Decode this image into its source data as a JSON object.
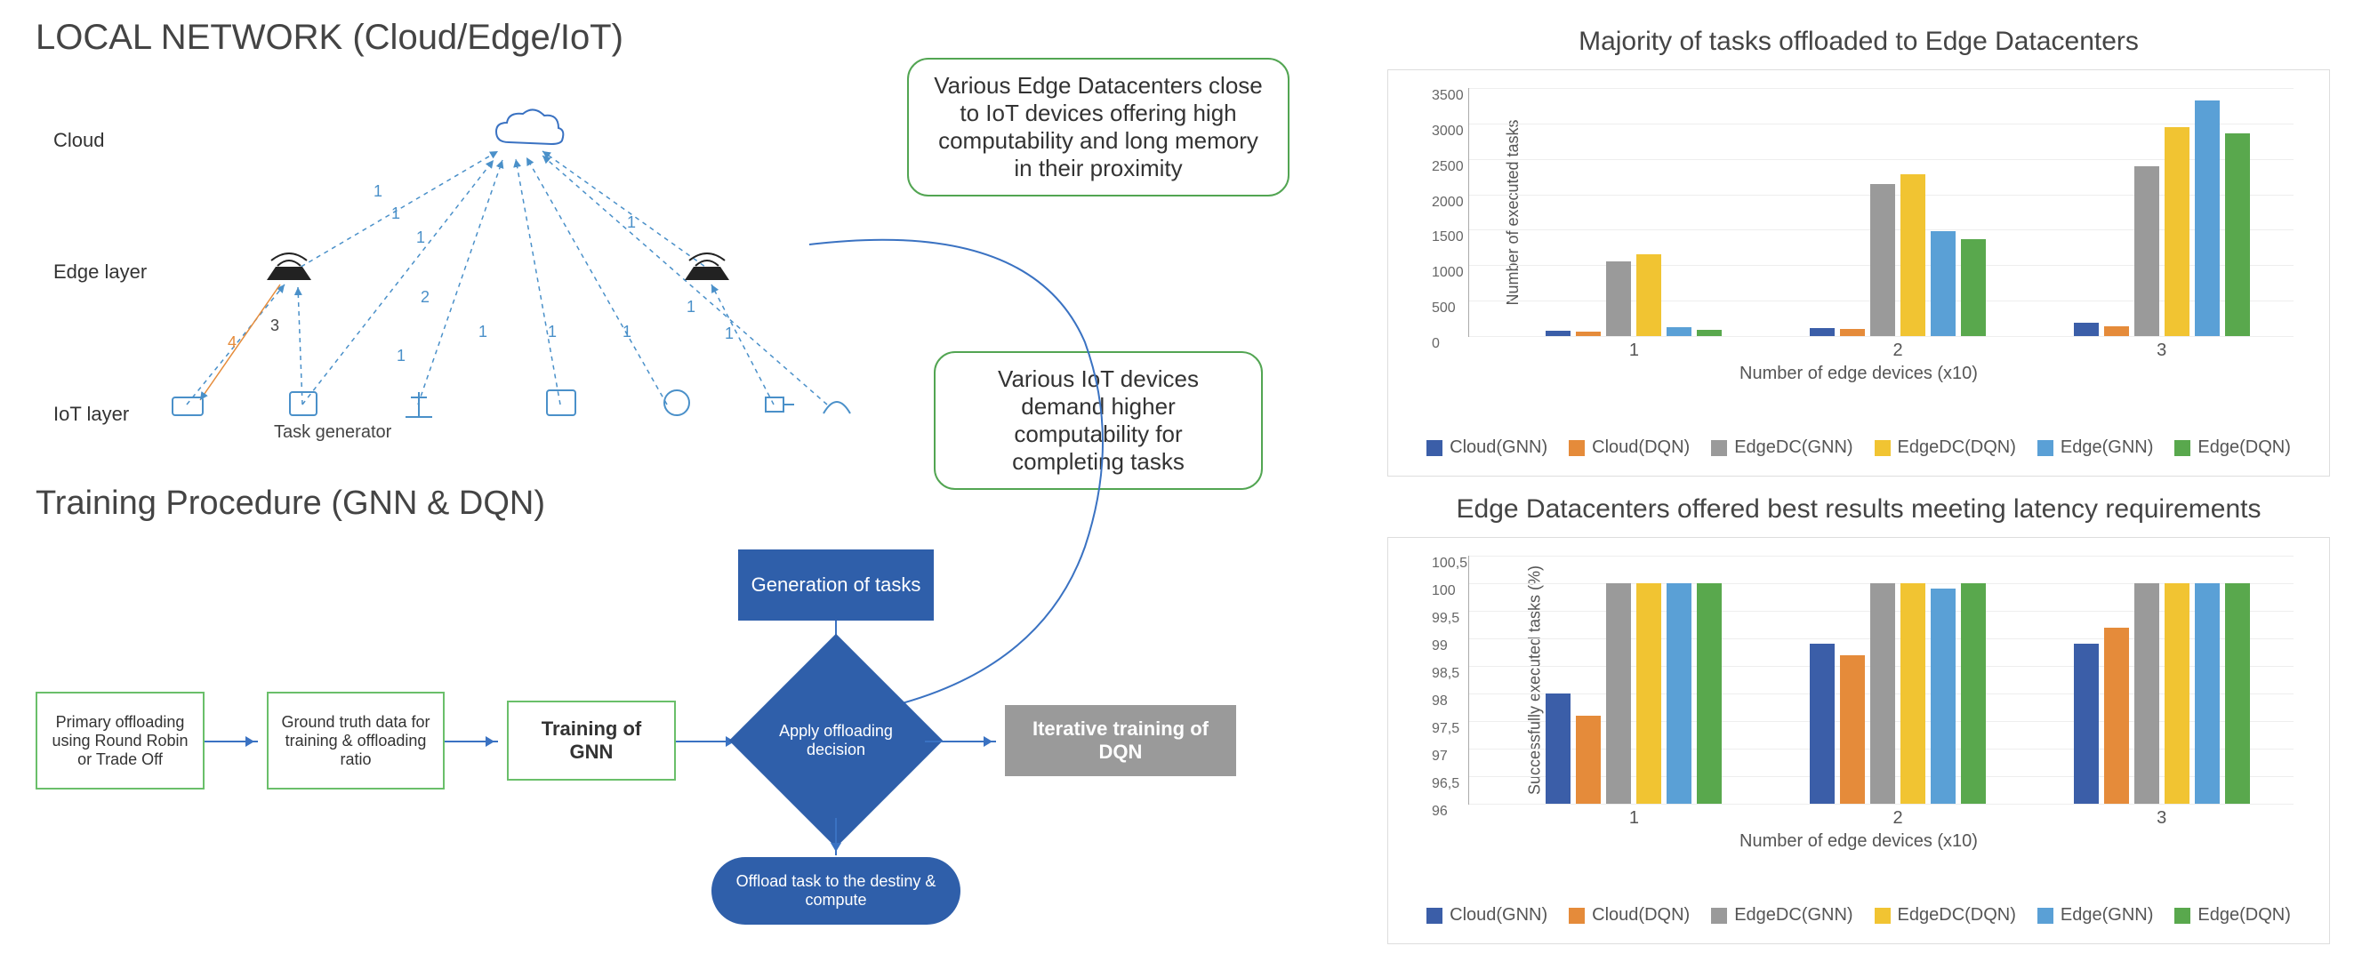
{
  "diagram": {
    "title1": "LOCAL NETWORK (Cloud/Edge/IoT)",
    "title2": "Training Procedure (GNN & DQN)",
    "layers": {
      "cloud": "Cloud",
      "edge": "Edge layer",
      "iot": "IoT layer"
    },
    "task_generator": "Task generator",
    "edge_weights": {
      "w1": "1",
      "w2": "2",
      "w3": "3",
      "w4": "4"
    },
    "callout_top": "Various Edge Datacenters close to IoT devices offering high computability and long memory in their proximity",
    "callout_mid": "Various IoT devices demand higher computability for completing tasks",
    "flow": {
      "primary": "Primary offloading using Round Robin or Trade Off",
      "ground": "Ground truth data for training & offloading ratio",
      "train_gnn": "Training of GNN",
      "gen_tasks": "Generation of tasks",
      "decision": "Apply offloading decision",
      "train_dqn": "Iterative training of DQN",
      "offload": "Offload task to the destiny & compute"
    }
  },
  "chart_data": [
    {
      "type": "bar",
      "title": "Majority of tasks offloaded to Edge Datacenters",
      "xlabel": "Number of edge devices (x10)",
      "ylabel": "Number of executed tasks",
      "categories": [
        "1",
        "2",
        "3"
      ],
      "ylim": [
        0,
        3500
      ],
      "yticks": [
        0,
        500,
        1000,
        1500,
        2000,
        2500,
        3000,
        3500
      ],
      "series": [
        {
          "name": "Cloud(GNN)",
          "color": "b-blue",
          "values": [
            70,
            110,
            190
          ]
        },
        {
          "name": "Cloud(DQN)",
          "color": "b-orange",
          "values": [
            60,
            100,
            140
          ]
        },
        {
          "name": "EdgeDC(GNN)",
          "color": "b-grey",
          "values": [
            1060,
            2150,
            2400
          ]
        },
        {
          "name": "EdgeDC(DQN)",
          "color": "b-yellow",
          "values": [
            1150,
            2280,
            2950
          ]
        },
        {
          "name": "Edge(GNN)",
          "color": "b-lblue",
          "values": [
            130,
            1480,
            3320
          ]
        },
        {
          "name": "Edge(DQN)",
          "color": "b-green",
          "values": [
            90,
            1370,
            2860
          ]
        }
      ]
    },
    {
      "type": "bar",
      "title": "Edge Datacenters offered best results meeting latency requirements",
      "xlabel": "Number of edge devices (x10)",
      "ylabel": "Successfully executed tasks (%)",
      "categories": [
        "1",
        "2",
        "3"
      ],
      "ylim": [
        96,
        100.5
      ],
      "yticks": [
        96,
        96.5,
        97,
        97.5,
        98,
        98.5,
        99,
        99.5,
        100,
        100.5
      ],
      "series": [
        {
          "name": "Cloud(GNN)",
          "color": "b-blue",
          "values": [
            98.0,
            98.9,
            98.9
          ]
        },
        {
          "name": "Cloud(DQN)",
          "color": "b-orange",
          "values": [
            97.6,
            98.7,
            99.2
          ]
        },
        {
          "name": "EdgeDC(GNN)",
          "color": "b-grey",
          "values": [
            100.0,
            100.0,
            100.0
          ]
        },
        {
          "name": "EdgeDC(DQN)",
          "color": "b-yellow",
          "values": [
            100.0,
            100.0,
            100.0
          ]
        },
        {
          "name": "Edge(GNN)",
          "color": "b-lblue",
          "values": [
            100.0,
            99.9,
            100.0
          ]
        },
        {
          "name": "Edge(DQN)",
          "color": "b-green",
          "values": [
            100.0,
            100.0,
            100.0
          ]
        }
      ]
    }
  ]
}
